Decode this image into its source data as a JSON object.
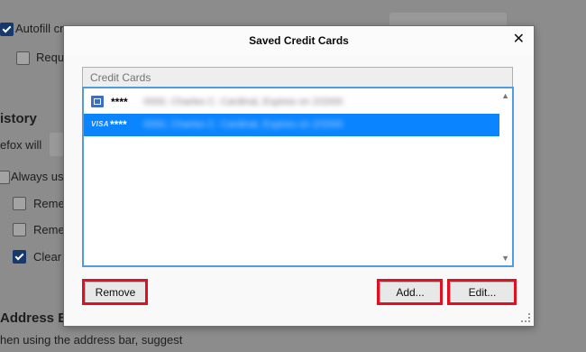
{
  "background": {
    "autofill_label": "Autofill cr",
    "require_label": "Requ",
    "history_heading": "istory",
    "firefox_will_label": "efox will",
    "always_use_label": "Always us",
    "remember1_label": "Reme",
    "remember2_label": "Reme",
    "clear_label": "Clear",
    "address_bar_heading": "Address Ba",
    "address_bar_desc": "hen using the address bar, suggest"
  },
  "dialog": {
    "title": "Saved Credit Cards",
    "close_glyph": "✕",
    "list_header": "Credit Cards",
    "cards": [
      {
        "mask": "****",
        "detail": "0000, Charles C. Cardinal, Expires on 2/2000"
      },
      {
        "mask": "****",
        "brand": "VISA",
        "detail": "0000, Charles C. Cardinal, Expires on 2/2000"
      }
    ],
    "buttons": {
      "remove": "Remove",
      "add": "Add...",
      "edit": "Edit..."
    }
  },
  "colors": {
    "selection": "#0a84ff",
    "highlight_box": "#e01020",
    "focus_border": "#4f9de0"
  }
}
